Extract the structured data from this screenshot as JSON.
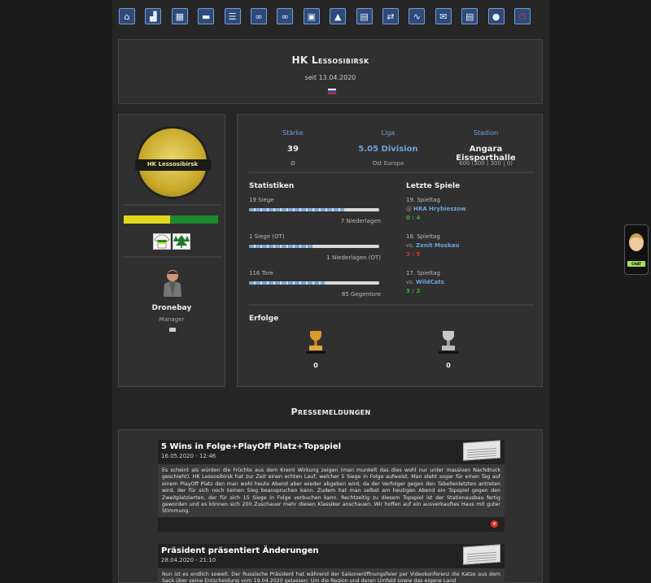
{
  "nav": {
    "items": [
      {
        "name": "home-icon",
        "glyph": "⌂"
      },
      {
        "name": "jersey-icon",
        "glyph": "▟"
      },
      {
        "name": "lineup-icon",
        "glyph": "▦"
      },
      {
        "name": "training-icon",
        "glyph": "▬"
      },
      {
        "name": "list-icon",
        "glyph": "☰"
      },
      {
        "name": "versus-icon",
        "glyph": "∞"
      },
      {
        "name": "match-icon",
        "glyph": "∞"
      },
      {
        "name": "film-icon",
        "glyph": "▣"
      },
      {
        "name": "stadium-icon",
        "glyph": "▲"
      },
      {
        "name": "finance-icon",
        "glyph": "▤"
      },
      {
        "name": "transfer-icon",
        "glyph": "⇄"
      },
      {
        "name": "stats-icon",
        "glyph": "∿"
      },
      {
        "name": "mail-icon",
        "glyph": "✉"
      },
      {
        "name": "table-icon",
        "glyph": "▤"
      },
      {
        "name": "chat-icon",
        "glyph": "●"
      },
      {
        "name": "logout-icon",
        "glyph": "⏻"
      }
    ]
  },
  "header": {
    "title": "HK Lessosibirsk",
    "since": "seit 13.04.2020"
  },
  "club": {
    "logo_text": "HK Lessosibirsk",
    "colors": {
      "primary": "#e0d91c",
      "secondary": "#1d8a2e"
    },
    "manager_name": "Dronebay",
    "manager_role": "Manager"
  },
  "summary": {
    "strength_label": "Stärke",
    "strength_value": "39",
    "strength_sub": "Ø",
    "league_label": "Liga",
    "league_value": "5.05 Division",
    "league_sub": "Ost Europa",
    "stadium_label": "Stadion",
    "stadium_value": "Angara Eissporthalle",
    "stadium_sub": "600 (300 | 300 | 0)"
  },
  "stats": {
    "heading": "Statistiken",
    "rows": [
      {
        "left": "19 Siege",
        "right": "7 Niederlagen",
        "fraction": 0.73
      },
      {
        "left": "1 Siege (OT)",
        "right": "1 Niederlagen (OT)",
        "fraction": 0.5
      },
      {
        "left": "116 Tore",
        "right": "85 Gegentore",
        "fraction": 0.58
      }
    ]
  },
  "games": {
    "heading": "Letzte Spiele",
    "items": [
      {
        "day": "19. Spieltag",
        "prefix": "@",
        "team": "HRA Hrybieszow",
        "score": "0 : 4",
        "score_color": "#3fae3f"
      },
      {
        "day": "18. Spieltag",
        "prefix": "vs.",
        "team": "Zenit Moskau",
        "score": "3 : 5",
        "score_color": "#d93030"
      },
      {
        "day": "17. Spieltag",
        "prefix": "vs.",
        "team": "WildCats",
        "score": "3 : 2",
        "score_color": "#3fae3f"
      }
    ]
  },
  "achievements": {
    "heading": "Erfolge",
    "gold_count": "0",
    "silver_count": "0"
  },
  "press": {
    "heading": "Pressemeldungen",
    "articles": [
      {
        "title": "5 Wins in Folge+PlayOff Platz+Topspiel",
        "date": "16.05.2020 - 12:46",
        "body": "Es scheint als würden die Früchte aus dem Kreml Wirkung zeigen (man munkelt das dies wohl nur unter massiven Nachdruck geschieht). HK Lessosibirsk hat zur Zeit einen echten Lauf, welcher 5 Siege in Folge aufweist. Man steht sogar für einen Tag auf einem PlayOff Platz den man wohl heute Abend aber wieder abgeben wird, da der Verfolger gegen den Tabellenletzten antreten wird, der für sich noch keinen Sieg beanspruchen kann. Zudem hat man selbst am heutigen Abend ein Topspiel gegen den Zweitplatzierten, der für sich 15 Siege in Folge verbuchen kann. Rechtzeitig zu diesem Topspiel ist der Stationausbau fertig geworden und es können sich 200 Zuschauer mehr diesen Klassiker anschauen. Wir hoffen auf ein ausverkauftes Haus mit guter Stimmung."
      },
      {
        "title": "Präsident präsentiert Änderungen",
        "date": "28.04.2020 - 21:10",
        "body": "Nun ist es endlich soweit. Der Russische Präsident hat während der Saisoneröffnungsfeier per Videokonferenz die Katze aus dem Sack über seine Entscheidung vom 19.04.2020 gelassen: Um die Region und deren Umfeld sowie das eigene Land"
      }
    ]
  },
  "chat_widget": {
    "label": "CHAT"
  }
}
